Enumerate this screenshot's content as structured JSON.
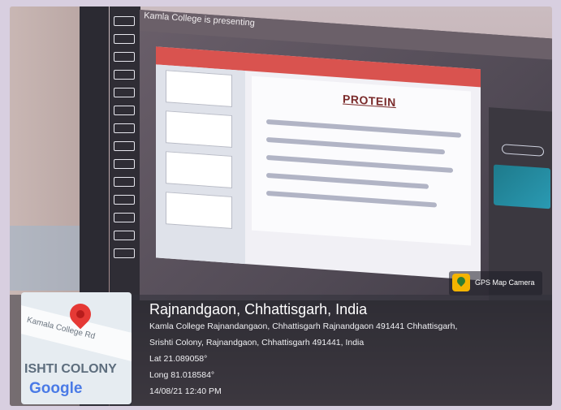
{
  "screen": {
    "presenting_label": "Kamla College is presenting",
    "slide_title": "PROTEIN"
  },
  "map": {
    "road_name": "Kamala College Rd",
    "area_name": "ISHTI COLONY",
    "brand": "Google"
  },
  "gps_camera": {
    "label": "GPS Map Camera"
  },
  "location": {
    "title": "Rajnandgaon, Chhattisgarh, India",
    "address_line1": "Kamla College Rajnandangaon, Chhattisgarh Rajnandgaon 491441 Chhattisgarh,",
    "address_line2": "Srishti Colony, Rajnandgaon, Chhattisgarh 491441, India",
    "lat": "Lat 21.089058°",
    "long": "Long 81.018584°",
    "datetime": "14/08/21 12:40 PM"
  }
}
